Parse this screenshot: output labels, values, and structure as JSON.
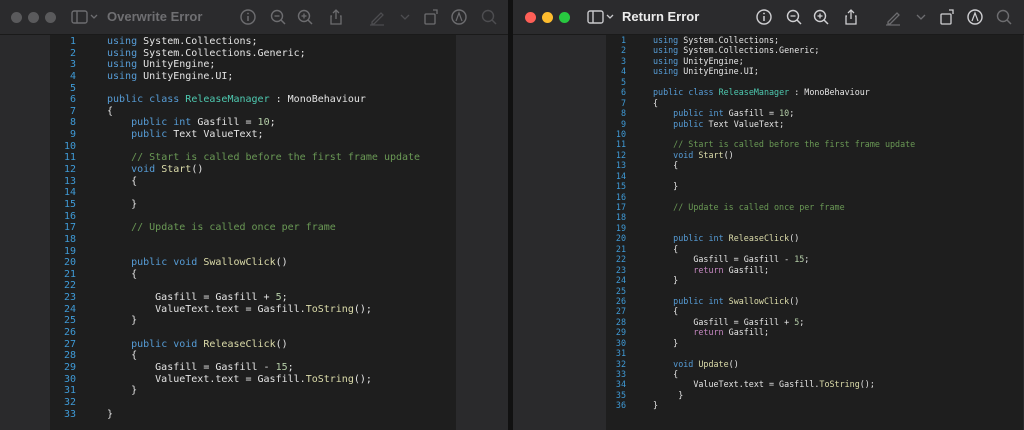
{
  "left_window": {
    "title": "Overwrite Error",
    "lines": [
      [
        [
          "kw",
          "using"
        ],
        [
          "tx",
          " System.Collections;"
        ]
      ],
      [
        [
          "kw",
          "using"
        ],
        [
          "tx",
          " System.Collections.Generic;"
        ]
      ],
      [
        [
          "kw",
          "using"
        ],
        [
          "tx",
          " UnityEngine;"
        ]
      ],
      [
        [
          "kw",
          "using"
        ],
        [
          "tx",
          " UnityEngine.UI;"
        ]
      ],
      [],
      [
        [
          "kw",
          "public"
        ],
        [
          "tx",
          " "
        ],
        [
          "kw",
          "class"
        ],
        [
          "tx",
          " "
        ],
        [
          "ty",
          "ReleaseManager"
        ],
        [
          "tx",
          " : MonoBehaviour"
        ]
      ],
      [
        [
          "tx",
          "{"
        ]
      ],
      [
        [
          "tx",
          "    "
        ],
        [
          "kw",
          "public"
        ],
        [
          "tx",
          " "
        ],
        [
          "kw",
          "int"
        ],
        [
          "tx",
          " Gasfill = "
        ],
        [
          "nm",
          "10"
        ],
        [
          "tx",
          ";"
        ]
      ],
      [
        [
          "tx",
          "    "
        ],
        [
          "kw",
          "public"
        ],
        [
          "tx",
          " Text ValueText;"
        ]
      ],
      [],
      [
        [
          "tx",
          "    "
        ],
        [
          "cm",
          "// Start is called before the first frame update"
        ]
      ],
      [
        [
          "tx",
          "    "
        ],
        [
          "kw",
          "void"
        ],
        [
          "tx",
          " "
        ],
        [
          "fn",
          "Start"
        ],
        [
          "tx",
          "()"
        ]
      ],
      [
        [
          "tx",
          "    {"
        ]
      ],
      [],
      [
        [
          "tx",
          "    }"
        ]
      ],
      [],
      [
        [
          "tx",
          "    "
        ],
        [
          "cm",
          "// Update is called once per frame"
        ]
      ],
      [],
      [],
      [
        [
          "tx",
          "    "
        ],
        [
          "kw",
          "public"
        ],
        [
          "tx",
          " "
        ],
        [
          "kw",
          "void"
        ],
        [
          "tx",
          " "
        ],
        [
          "fn",
          "SwallowClick"
        ],
        [
          "tx",
          "()"
        ]
      ],
      [
        [
          "tx",
          "    {"
        ]
      ],
      [],
      [
        [
          "tx",
          "        Gasfill = Gasfill + "
        ],
        [
          "nm",
          "5"
        ],
        [
          "tx",
          ";"
        ]
      ],
      [
        [
          "tx",
          "        ValueText.text = Gasfill."
        ],
        [
          "fn",
          "ToString"
        ],
        [
          "tx",
          "();"
        ]
      ],
      [
        [
          "tx",
          "    }"
        ]
      ],
      [],
      [
        [
          "tx",
          "    "
        ],
        [
          "kw",
          "public"
        ],
        [
          "tx",
          " "
        ],
        [
          "kw",
          "void"
        ],
        [
          "tx",
          " "
        ],
        [
          "fn",
          "ReleaseClick"
        ],
        [
          "tx",
          "()"
        ]
      ],
      [
        [
          "tx",
          "    {"
        ]
      ],
      [
        [
          "tx",
          "        Gasfill = Gasfill - "
        ],
        [
          "nm",
          "15"
        ],
        [
          "tx",
          ";"
        ]
      ],
      [
        [
          "tx",
          "        ValueText.text = Gasfill."
        ],
        [
          "fn",
          "ToString"
        ],
        [
          "tx",
          "();"
        ]
      ],
      [
        [
          "tx",
          "    }"
        ]
      ],
      [],
      [
        [
          "tx",
          "}"
        ]
      ]
    ]
  },
  "right_window": {
    "title": "Return Error",
    "lines": [
      [
        [
          "kw",
          "using"
        ],
        [
          "tx",
          " System.Collections;"
        ]
      ],
      [
        [
          "kw",
          "using"
        ],
        [
          "tx",
          " System.Collections.Generic;"
        ]
      ],
      [
        [
          "kw",
          "using"
        ],
        [
          "tx",
          " UnityEngine;"
        ]
      ],
      [
        [
          "kw",
          "using"
        ],
        [
          "tx",
          " UnityEngine.UI;"
        ]
      ],
      [],
      [
        [
          "kw",
          "public"
        ],
        [
          "tx",
          " "
        ],
        [
          "kw",
          "class"
        ],
        [
          "tx",
          " "
        ],
        [
          "ty",
          "ReleaseManager"
        ],
        [
          "tx",
          " : MonoBehaviour"
        ]
      ],
      [
        [
          "tx",
          "{"
        ]
      ],
      [
        [
          "tx",
          "    "
        ],
        [
          "kw",
          "public"
        ],
        [
          "tx",
          " "
        ],
        [
          "kw",
          "int"
        ],
        [
          "tx",
          " Gasfill = "
        ],
        [
          "nm",
          "10"
        ],
        [
          "tx",
          ";"
        ]
      ],
      [
        [
          "tx",
          "    "
        ],
        [
          "kw",
          "public"
        ],
        [
          "tx",
          " Text ValueText;"
        ]
      ],
      [],
      [
        [
          "tx",
          "    "
        ],
        [
          "cm",
          "// Start is called before the first frame update"
        ]
      ],
      [
        [
          "tx",
          "    "
        ],
        [
          "kw",
          "void"
        ],
        [
          "tx",
          " "
        ],
        [
          "fn",
          "Start"
        ],
        [
          "tx",
          "()"
        ]
      ],
      [
        [
          "tx",
          "    {"
        ]
      ],
      [],
      [
        [
          "tx",
          "    }"
        ]
      ],
      [],
      [
        [
          "tx",
          "    "
        ],
        [
          "cm",
          "// Update is called once per frame"
        ]
      ],
      [],
      [],
      [
        [
          "tx",
          "    "
        ],
        [
          "kw",
          "public"
        ],
        [
          "tx",
          " "
        ],
        [
          "kw",
          "int"
        ],
        [
          "tx",
          " "
        ],
        [
          "fn",
          "ReleaseClick"
        ],
        [
          "tx",
          "()"
        ]
      ],
      [
        [
          "tx",
          "    {"
        ]
      ],
      [
        [
          "tx",
          "        Gasfill = Gasfill - "
        ],
        [
          "nm",
          "15"
        ],
        [
          "tx",
          ";"
        ]
      ],
      [
        [
          "tx",
          "        "
        ],
        [
          "ctl",
          "return"
        ],
        [
          "tx",
          " Gasfill;"
        ]
      ],
      [
        [
          "tx",
          "    }"
        ]
      ],
      [],
      [
        [
          "tx",
          "    "
        ],
        [
          "kw",
          "public"
        ],
        [
          "tx",
          " "
        ],
        [
          "kw",
          "int"
        ],
        [
          "tx",
          " "
        ],
        [
          "fn",
          "SwallowClick"
        ],
        [
          "tx",
          "()"
        ]
      ],
      [
        [
          "tx",
          "    {"
        ]
      ],
      [
        [
          "tx",
          "        Gasfill = Gasfill + "
        ],
        [
          "nm",
          "5"
        ],
        [
          "tx",
          ";"
        ]
      ],
      [
        [
          "tx",
          "        "
        ],
        [
          "ctl",
          "return"
        ],
        [
          "tx",
          " Gasfill;"
        ]
      ],
      [
        [
          "tx",
          "    }"
        ]
      ],
      [],
      [
        [
          "tx",
          "    "
        ],
        [
          "kw",
          "void"
        ],
        [
          "tx",
          " "
        ],
        [
          "fn",
          "Update"
        ],
        [
          "tx",
          "()"
        ]
      ],
      [
        [
          "tx",
          "    {"
        ]
      ],
      [
        [
          "tx",
          "        ValueText.text = Gasfill."
        ],
        [
          "fn",
          "ToString"
        ],
        [
          "tx",
          "();"
        ]
      ],
      [
        [
          "tx",
          "     }"
        ]
      ],
      [
        [
          "tx",
          "}"
        ]
      ]
    ]
  }
}
